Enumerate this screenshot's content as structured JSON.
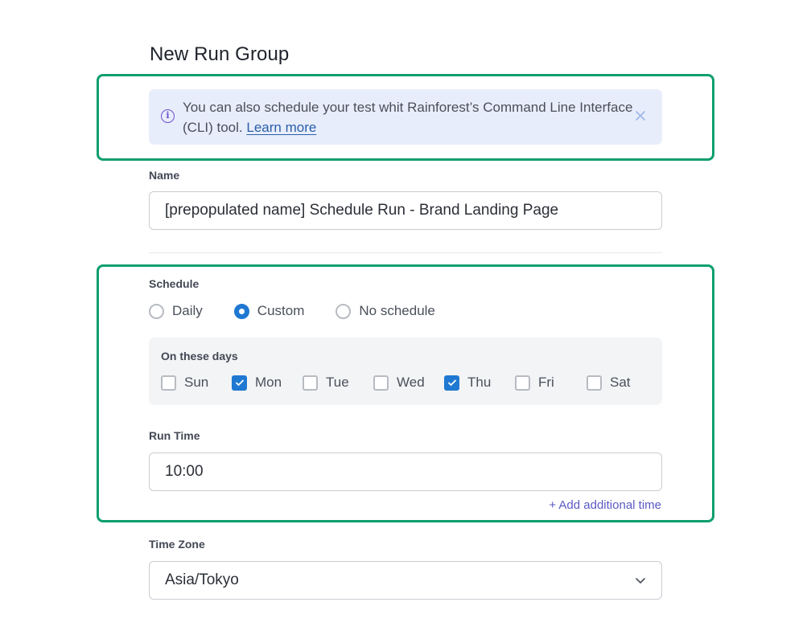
{
  "page": {
    "title": "New Run Group"
  },
  "banner": {
    "icon": "info-icon",
    "message": "You can also schedule your test whit Rainforest’s Command Line Interface (CLI) tool.",
    "link_text": "Learn more",
    "close_icon": "close-icon"
  },
  "name_field": {
    "label": "Name",
    "value": "[prepopulated name] Schedule Run - Brand Landing Page"
  },
  "schedule": {
    "label": "Schedule",
    "options": [
      {
        "label": "Daily",
        "selected": false
      },
      {
        "label": "Custom",
        "selected": true
      },
      {
        "label": "No schedule",
        "selected": false
      }
    ],
    "days_label": "On these days",
    "days": [
      {
        "label": "Sun",
        "checked": false
      },
      {
        "label": "Mon",
        "checked": true
      },
      {
        "label": "Tue",
        "checked": false
      },
      {
        "label": "Wed",
        "checked": false
      },
      {
        "label": "Thu",
        "checked": true
      },
      {
        "label": "Fri",
        "checked": false
      },
      {
        "label": "Sat",
        "checked": false
      }
    ]
  },
  "run_time": {
    "label": "Run Time",
    "value": "10:00",
    "add_label": "+ Add additional time"
  },
  "time_zone": {
    "label": "Time Zone",
    "value": "Asia/Tokyo"
  },
  "colors": {
    "highlight": "#0e9f6e",
    "primary": "#1f78d1",
    "banner_bg": "#e8edfb",
    "link": "#2a5ea8",
    "add_link": "#5a59c4"
  }
}
